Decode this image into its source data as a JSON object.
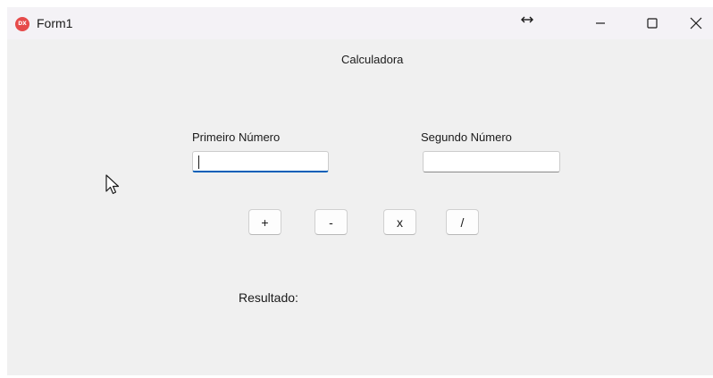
{
  "window": {
    "title": "Form1",
    "app_icon_text": "DX"
  },
  "form": {
    "title": "Calculadora",
    "first_number_label": "Primeiro Número",
    "first_number_value": "",
    "second_number_label": "Segundo Número",
    "second_number_value": "",
    "buttons": {
      "add": "+",
      "subtract": "-",
      "multiply": "x",
      "divide": "/"
    },
    "result_label": "Resultado:"
  },
  "colors": {
    "form_background": "#f0f0f0",
    "titlebar_background": "#f4f2f6",
    "focus_accent": "#005fb8",
    "app_icon": "#e64b4b"
  },
  "icons": {
    "resize": "resize-horizontal-icon",
    "minimize": "minimize-icon",
    "maximize": "maximize-icon",
    "close": "close-icon",
    "pointer": "mouse-pointer-icon"
  }
}
